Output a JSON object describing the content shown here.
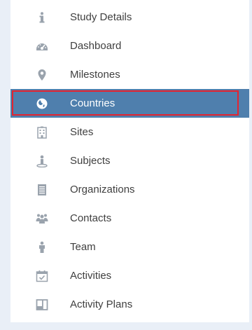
{
  "sidebar": {
    "items": [
      {
        "label": "Study Details",
        "icon": "info-icon",
        "active": false
      },
      {
        "label": "Dashboard",
        "icon": "gauge-icon",
        "active": false
      },
      {
        "label": "Milestones",
        "icon": "map-pin-icon",
        "active": false
      },
      {
        "label": "Countries",
        "icon": "globe-icon",
        "active": true
      },
      {
        "label": "Sites",
        "icon": "building-icon",
        "active": false
      },
      {
        "label": "Subjects",
        "icon": "person-pin-icon",
        "active": false
      },
      {
        "label": "Organizations",
        "icon": "document-icon",
        "active": false
      },
      {
        "label": "Contacts",
        "icon": "group-icon",
        "active": false
      },
      {
        "label": "Team",
        "icon": "person-icon",
        "active": false
      },
      {
        "label": "Activities",
        "icon": "calendar-check-icon",
        "active": false
      },
      {
        "label": "Activity Plans",
        "icon": "board-icon",
        "active": false
      }
    ]
  },
  "colors": {
    "icon": "#9aa3ad",
    "active_background": "#4f7fad",
    "active_text": "#ffffff",
    "text": "#3f3f3f",
    "highlight_border": "#e5232f",
    "page_background": "#e9eff7"
  }
}
